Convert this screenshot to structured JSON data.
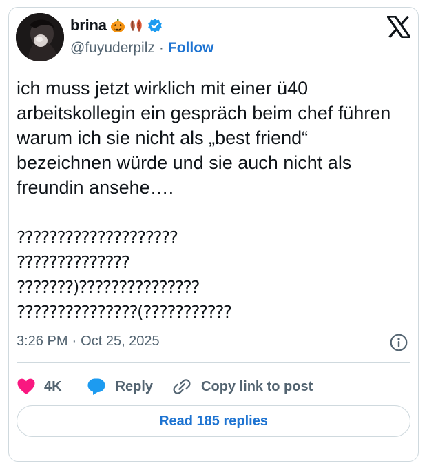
{
  "author": {
    "display_name": "brina",
    "name_emojis": [
      "pumpkin-emoji",
      "leaves-emoji"
    ],
    "verified": true,
    "handle": "@fuyuderpilz",
    "separator": "·",
    "follow_label": "Follow"
  },
  "tweet": {
    "text": "ich muss jetzt wirklich mit einer ü40 arbeitskollegin ein gespräch beim chef führen warum ich sie nicht als „best friend“ bezeichnen würde und sie auch nicht als freundin ansehe….",
    "symbols": "????????????????????\n??????????????\n???????)???????????????\n???????????????(???????????",
    "time": "3:26 PM",
    "time_separator": "·",
    "date": "Oct 25, 2025"
  },
  "actions": {
    "like_count": "4K",
    "reply_label": "Reply",
    "copy_label": "Copy link to post"
  },
  "read_replies_label": "Read 185 replies",
  "colors": {
    "accent": "#1d73d1",
    "like": "#f91880",
    "reply_icon": "#1d9bf0",
    "verified": "#1d9bf0",
    "muted": "#536471",
    "border": "#cfd9de"
  },
  "icons": {
    "logo": "x-logo-icon",
    "verified": "verified-badge-icon",
    "info": "info-icon",
    "like": "heart-icon",
    "reply": "speech-bubble-icon",
    "copy": "link-icon"
  }
}
